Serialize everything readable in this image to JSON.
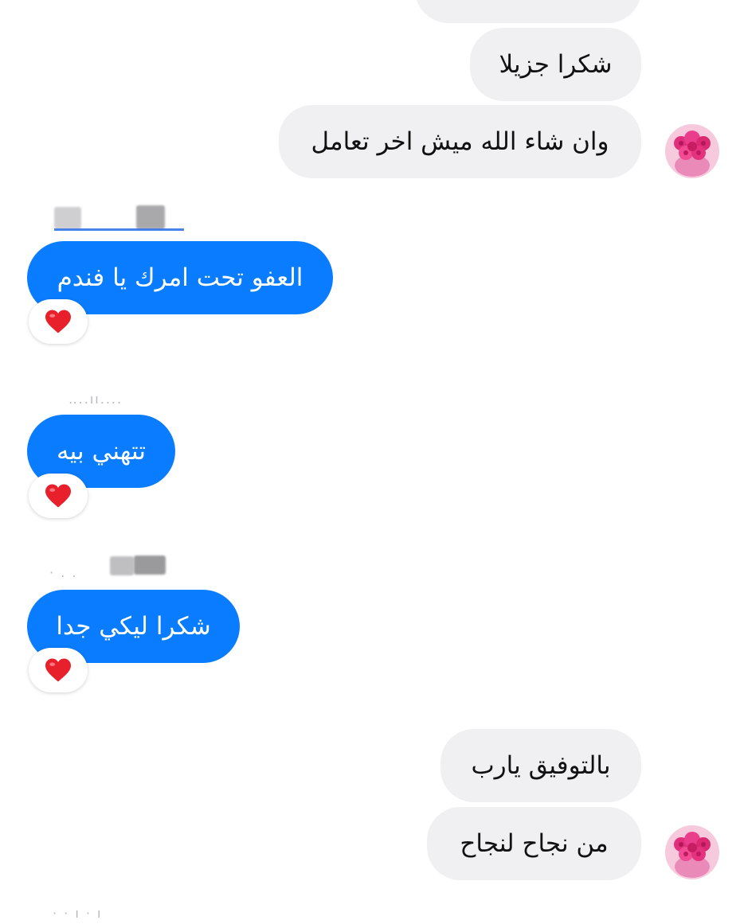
{
  "messages": [
    {
      "id": "m0",
      "side": "incoming",
      "text": ""
    },
    {
      "id": "m1",
      "side": "incoming",
      "text": "شكرا جزيلا"
    },
    {
      "id": "m2",
      "side": "incoming",
      "text": "وان شاء الله ميش اخر تعامل"
    },
    {
      "id": "m3",
      "side": "outgoing",
      "text": "العفو تحت امرك يا فندم",
      "reaction": "heart"
    },
    {
      "id": "m4",
      "side": "outgoing",
      "text": "تتهني بيه",
      "reaction": "heart"
    },
    {
      "id": "m5",
      "side": "outgoing",
      "text": "شكرا ليكي جدا",
      "reaction": "heart"
    },
    {
      "id": "m6",
      "side": "incoming",
      "text": "بالتوفيق يارب"
    },
    {
      "id": "m7",
      "side": "incoming",
      "text": "من نجاح لنجاح"
    }
  ],
  "icons": {
    "avatar": "pink-roses-avatar",
    "reaction": "heart-icon"
  },
  "colors": {
    "incoming_bubble": "#f0f0f2",
    "outgoing_bubble": "#0a7cff",
    "heart": "#e8202b"
  }
}
